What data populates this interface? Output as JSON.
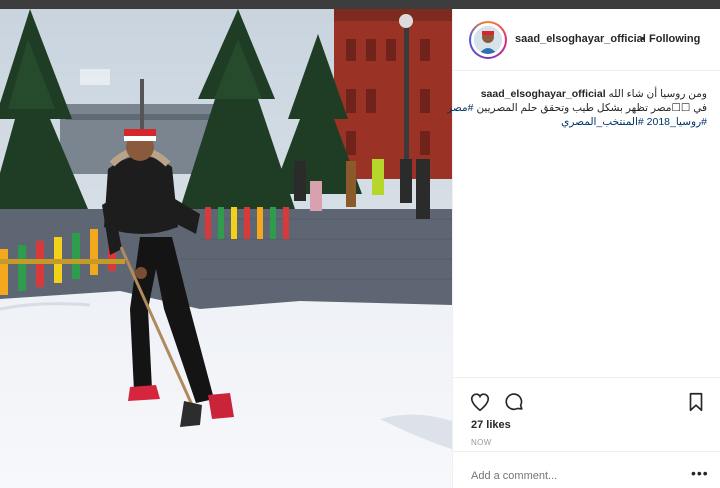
{
  "post": {
    "username": "saad_elsoghayar_official",
    "separator": "•",
    "follow_label": "Following",
    "caption": {
      "username": "saad_elsoghayar_official",
      "line1_text": "ومن روسيا أن شاء الله",
      "line2_text": "في ☐☐مصر تظهر بشكل طيب وتحقق حلم المصريين",
      "line2_tag": "#مصر",
      "line3_tags": "#روسيا_2018 #المنتخب_المصري"
    },
    "likes": "27 likes",
    "timestamp": "NOW",
    "comment_placeholder": "Add a comment...",
    "more_label": "•••"
  },
  "icons": {
    "like": "heart-icon",
    "comment": "comment-icon",
    "save": "bookmark-icon",
    "more": "more-options-icon"
  },
  "colors": {
    "link": "#003569",
    "muted": "#999999",
    "divider": "#efefef"
  }
}
